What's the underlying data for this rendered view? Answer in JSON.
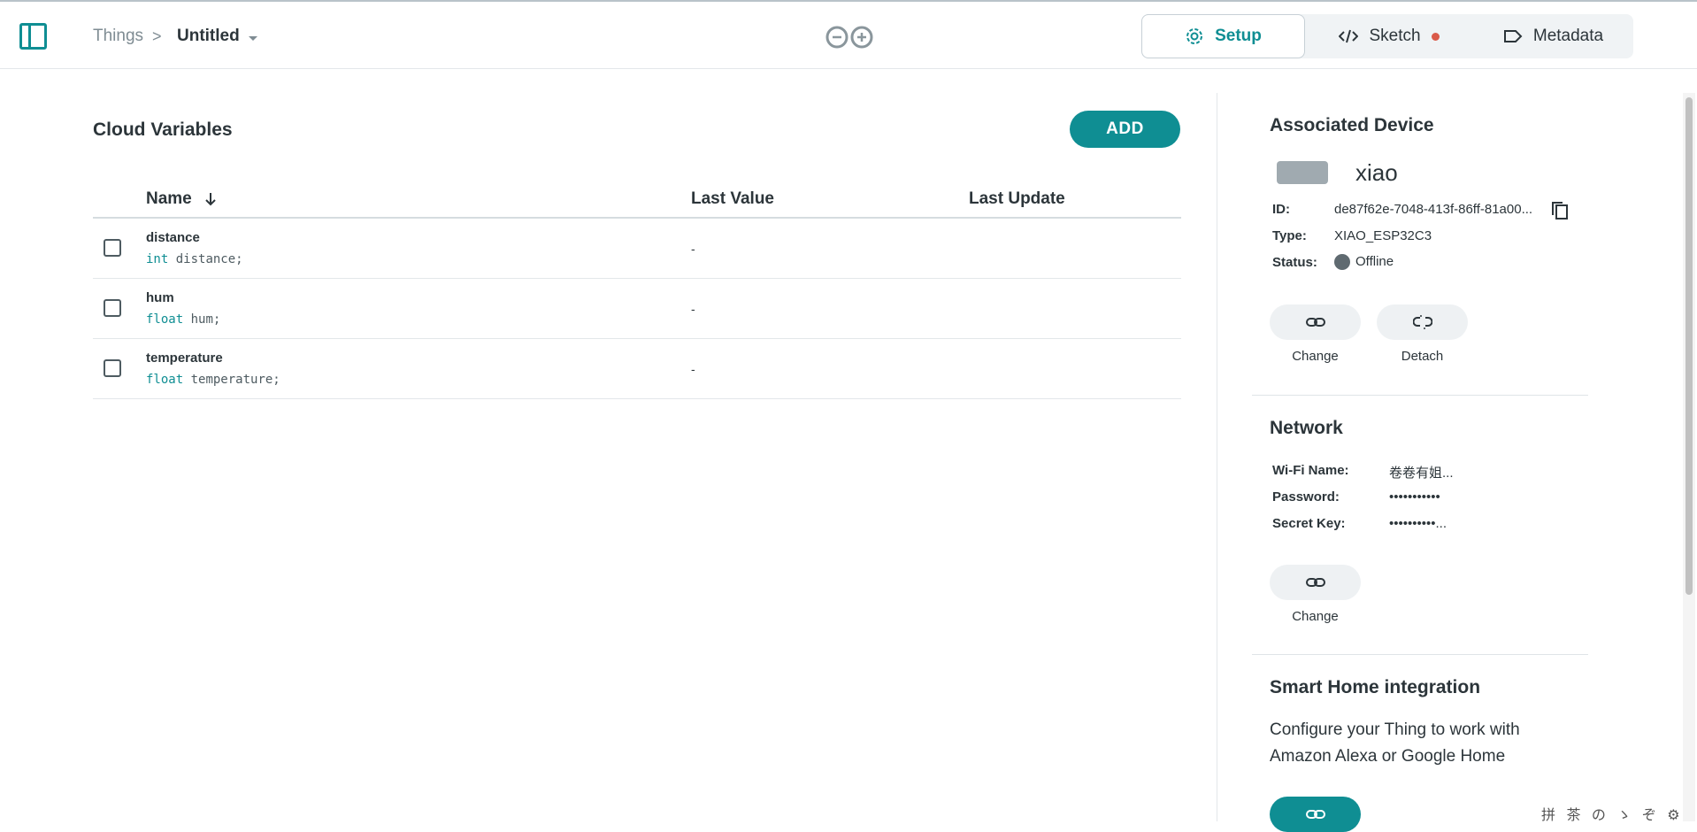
{
  "breadcrumb": {
    "root": "Things",
    "separator": ">",
    "title": "Untitled"
  },
  "tabs": [
    {
      "label": "Setup",
      "icon": "gear-icon",
      "active": true
    },
    {
      "label": "Sketch",
      "icon": "code-icon",
      "unsaved_dot": true
    },
    {
      "label": "Metadata",
      "icon": "tag-icon"
    }
  ],
  "cloud_variables": {
    "title": "Cloud Variables",
    "add_label": "ADD",
    "columns": [
      "Name",
      "Last Value",
      "Last Update"
    ],
    "rows": [
      {
        "name": "distance",
        "type": "int",
        "decl": "distance;",
        "last_value": "-",
        "last_update": ""
      },
      {
        "name": "hum",
        "type": "float",
        "decl": "hum;",
        "last_value": "-",
        "last_update": ""
      },
      {
        "name": "temperature",
        "type": "float",
        "decl": "temperature;",
        "last_value": "-",
        "last_update": ""
      }
    ]
  },
  "device": {
    "title": "Associated Device",
    "name": "xiao",
    "id_label": "ID:",
    "id": "de87f62e-7048-413f-86ff-81a00...",
    "type_label": "Type:",
    "type": "XIAO_ESP32C3",
    "status_label": "Status:",
    "status": "Offline",
    "change_label": "Change",
    "detach_label": "Detach"
  },
  "network": {
    "title": "Network",
    "wifi_label": "Wi-Fi Name:",
    "wifi": "卷卷有姐...",
    "password_label": "Password:",
    "password": "•••••••••••",
    "secret_label": "Secret Key:",
    "secret": "••••••••••...",
    "change_label": "Change"
  },
  "smart_home": {
    "title": "Smart Home integration",
    "text": "Configure your Thing to work with Amazon Alexa or Google Home"
  },
  "ime_status": "拼 茶 の ゝ ぞ ⚙",
  "colors": {
    "accent": "#0f8e93",
    "unsaved": "#da5b4a",
    "offline": "#5f6a70"
  }
}
